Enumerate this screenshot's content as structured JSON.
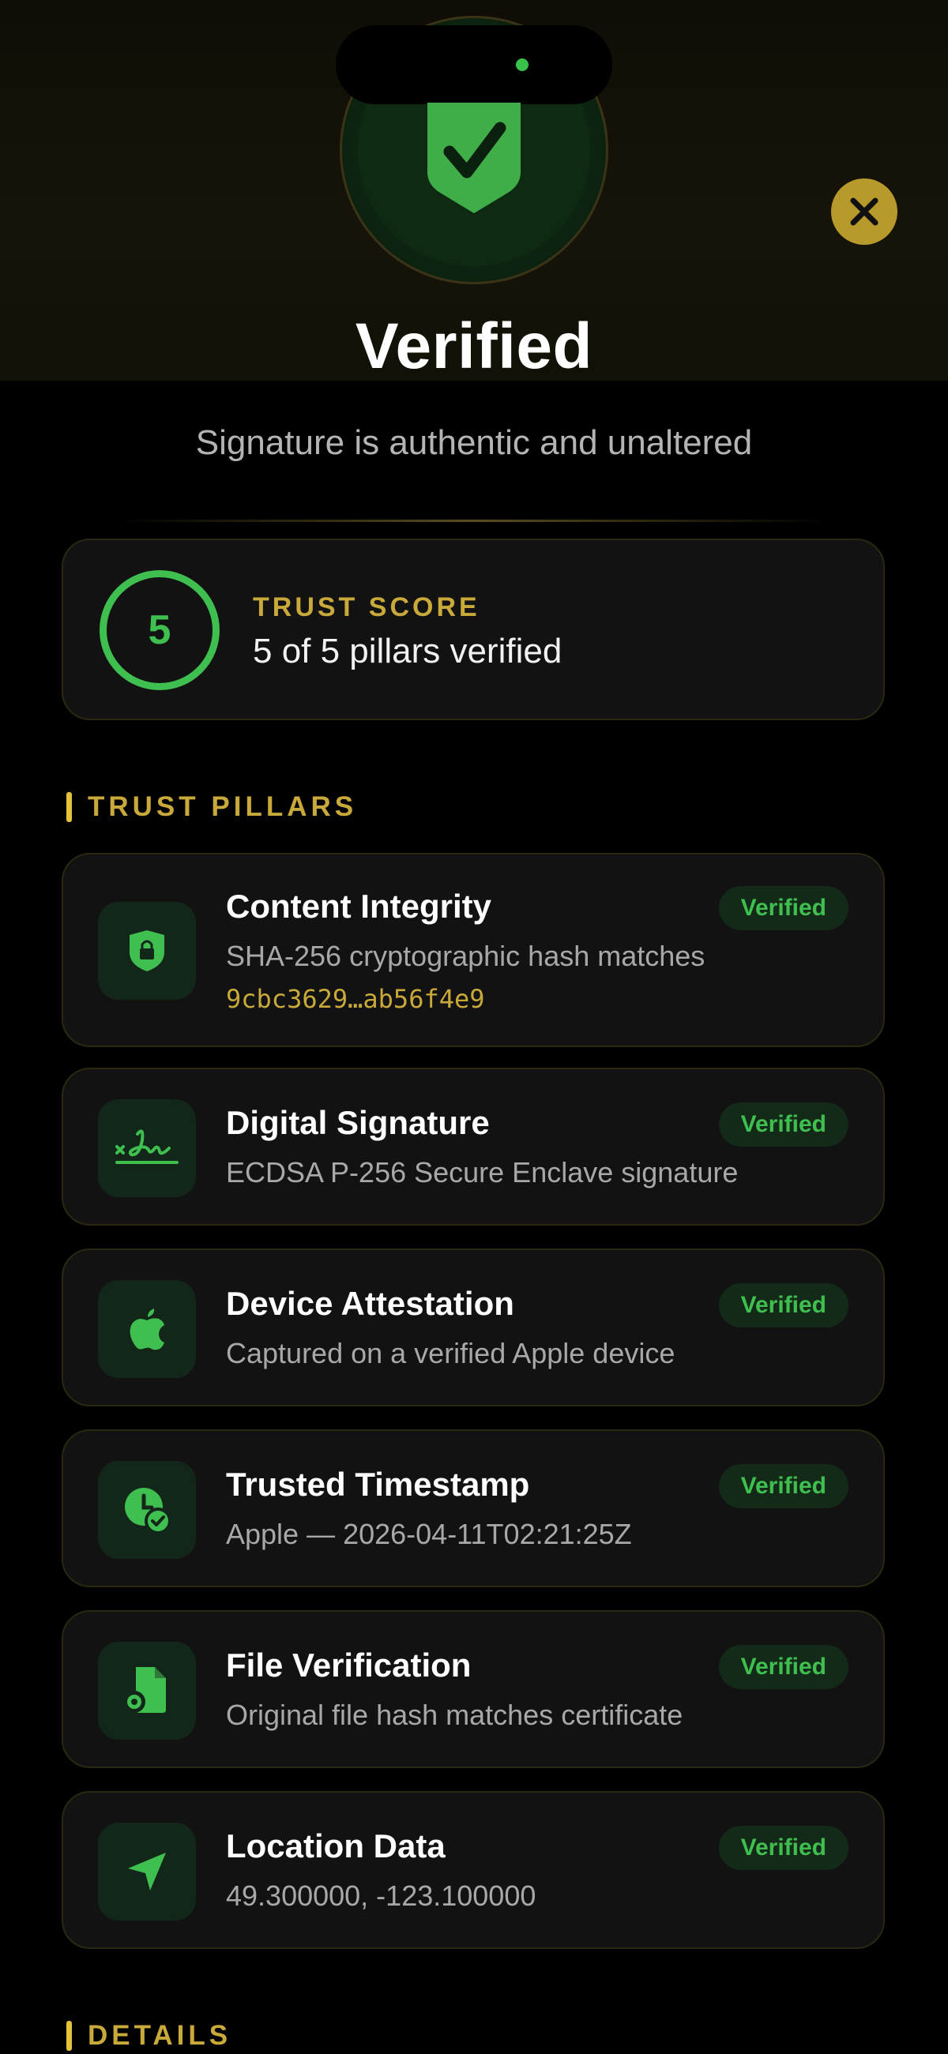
{
  "header": {
    "title": "Verified",
    "subtitle": "Signature is authentic and unaltered"
  },
  "trust_score": {
    "value": "5",
    "label": "TRUST SCORE",
    "summary": "5 of 5 pillars verified"
  },
  "sections": {
    "pillars_title": "TRUST PILLARS",
    "details_title": "DETAILS"
  },
  "pillars": [
    {
      "title": "Content Integrity",
      "description": "SHA-256 cryptographic hash matches",
      "hash": "9cbc3629…ab56f4e9",
      "status": "Verified",
      "icon": "lock-shield-icon"
    },
    {
      "title": "Digital Signature",
      "description": "ECDSA P-256 Secure Enclave signature",
      "status": "Verified",
      "icon": "signature-icon"
    },
    {
      "title": "Device Attestation",
      "description": "Captured on a verified Apple device",
      "status": "Verified",
      "icon": "apple-icon"
    },
    {
      "title": "Trusted Timestamp",
      "description": "Apple — 2026-04-11T02:21:25Z",
      "status": "Verified",
      "icon": "clock-check-icon"
    },
    {
      "title": "File Verification",
      "description": "Original file hash matches certificate",
      "status": "Verified",
      "icon": "file-gear-icon"
    },
    {
      "title": "Location Data",
      "description": "49.300000, -123.100000",
      "status": "Verified",
      "icon": "location-arrow-icon"
    }
  ],
  "colors": {
    "accent_gold": "#c9a93a",
    "success_green": "#3fbf4f",
    "close_button": "#b89a2c"
  }
}
